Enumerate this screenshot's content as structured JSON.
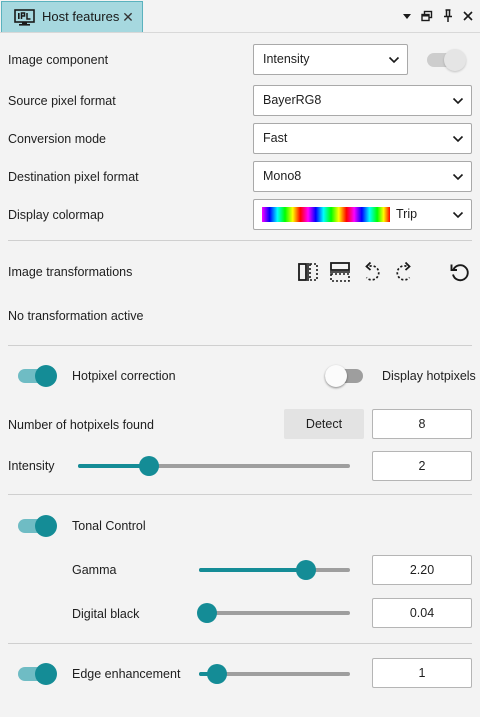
{
  "tab": {
    "title": "Host features",
    "icon": "ipl-monitor-icon",
    "close_icon": "close-icon"
  },
  "window_buttons": [
    "dropdown-caret-icon",
    "restore-window-icon",
    "pin-icon",
    "close-icon"
  ],
  "image_component": {
    "label": "Image component",
    "value": "Intensity",
    "toggle_state": "on-disabled"
  },
  "source_pixel_format": {
    "label": "Source pixel format",
    "value": "BayerRG8"
  },
  "conversion_mode": {
    "label": "Conversion mode",
    "value": "Fast"
  },
  "destination_pixel_format": {
    "label": "Destination pixel format",
    "value": "Mono8"
  },
  "display_colormap": {
    "label": "Display colormap",
    "value": "Trip"
  },
  "transformations": {
    "label": "Image transformations",
    "status": "No transformation active",
    "icons": [
      "flip-horizontal-icon",
      "flip-vertical-icon",
      "rotate-left-icon",
      "rotate-right-icon",
      "reset-icon"
    ]
  },
  "hotpixel": {
    "correction_label": "Hotpixel correction",
    "correction_on": true,
    "display_label": "Display hotpixels",
    "display_on": false,
    "found_label": "Number of hotpixels found",
    "detect_label": "Detect",
    "found_value": "8",
    "intensity_label": "Intensity",
    "intensity_value": "2",
    "intensity_fraction": 0.26
  },
  "tonal": {
    "label": "Tonal Control",
    "on": true,
    "gamma_label": "Gamma",
    "gamma_value": "2.20",
    "gamma_fraction": 0.71,
    "black_label": "Digital black",
    "black_value": "0.04",
    "black_fraction": 0.05
  },
  "edge": {
    "label": "Edge enhancement",
    "on": true,
    "value": "1",
    "fraction": 0.12
  },
  "colors": {
    "accent": "#148c96",
    "accent_light": "#6fbcc4",
    "tab_bg": "#a6d8df",
    "panel_bg": "#f3f3f3"
  }
}
